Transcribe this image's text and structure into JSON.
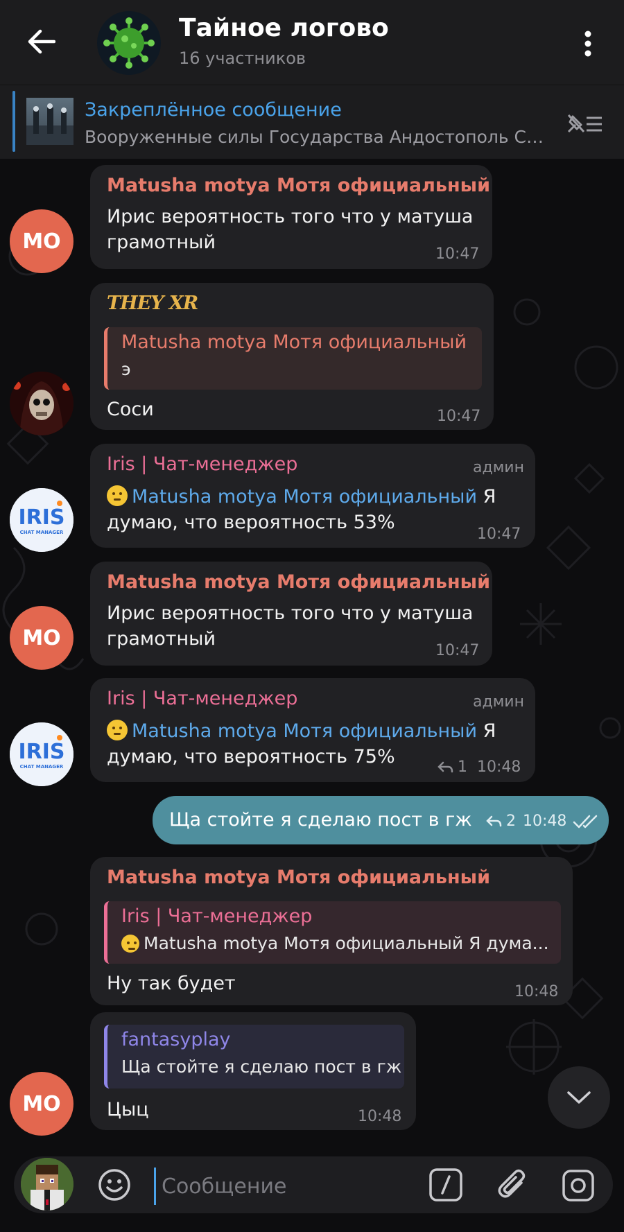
{
  "header": {
    "title": "Тайное логово",
    "subtitle": "16 участников"
  },
  "pinned": {
    "title": "Закреплённое сообщение",
    "text": "Вооруженные силы Государства Андостополь  Сол..."
  },
  "messages": [
    {
      "avatar": "МО",
      "sender": "Matusha motya Мотя официальный",
      "line1": "Ирис вероятность того что у матуша",
      "line2": "грамотный",
      "time": "10:47"
    },
    {
      "sender": "THEY XR",
      "reply_name": "Matusha motya Мотя официальный",
      "reply_text": "э",
      "text": "Соси",
      "time": "10:47"
    },
    {
      "sender": "Iris | Чат-менеджер",
      "role": "админ",
      "mention": "Matusha motya Мотя официальный",
      "after_mention": " Я",
      "line2": "думаю, что вероятность 53%",
      "time": "10:47"
    },
    {
      "avatar": "МО",
      "sender": "Matusha motya Мотя официальный",
      "line1": "Ирис вероятность того что у матуша",
      "line2": "грамотный",
      "time": "10:47"
    },
    {
      "sender": "Iris | Чат-менеджер",
      "role": "админ",
      "mention": "Matusha motya Мотя официальный",
      "after_mention": " Я",
      "line2": "думаю, что вероятность 75%",
      "replies": "1",
      "time": "10:48"
    },
    {
      "own": true,
      "text": "Ща стойте я сделаю пост в гж",
      "replies": "2",
      "time": "10:48"
    },
    {
      "sender": "Matusha motya Мотя официальный",
      "reply_name": "Iris | Чат-менеджер",
      "reply_text": "Matusha motya Мотя официальный Я дума...",
      "text": "Ну так будет",
      "time": "10:48"
    },
    {
      "avatar": "МО",
      "reply_name": "fantasyplay",
      "reply_text": "Ща стойте я сделаю пост в гж",
      "text": "Цыц",
      "time": "10:48"
    }
  ],
  "composer": {
    "placeholder": "Сообщение"
  },
  "colors": {
    "header_bg": "#1c1c1e",
    "bubble_in": "#212124",
    "bubble_out": "#4f8f9e",
    "accent": "#4aa3ea",
    "name_matusha": "#e77c6c",
    "name_they": "#e7b44c",
    "name_iris": "#ec6f96",
    "name_fantasy": "#8f86e8"
  }
}
